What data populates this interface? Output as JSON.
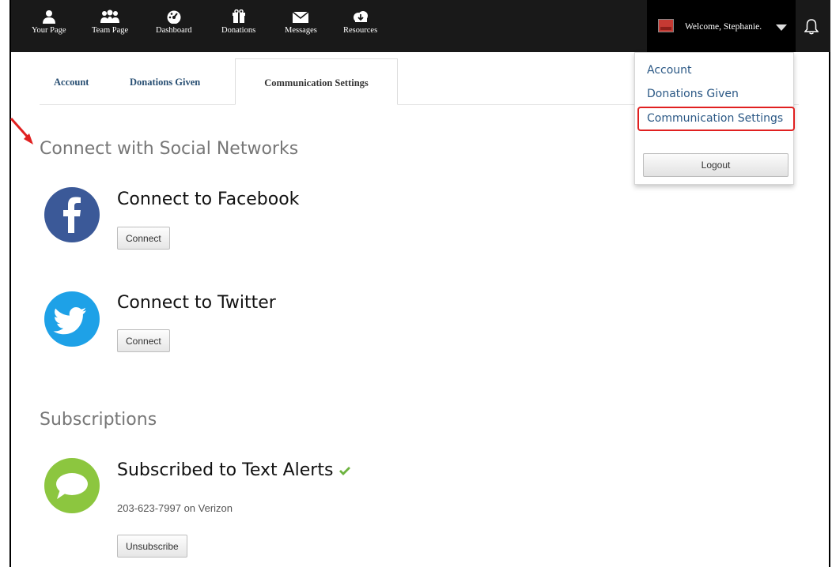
{
  "nav": {
    "items": [
      {
        "label": "Your Page",
        "icon": "user-icon"
      },
      {
        "label": "Team Page",
        "icon": "team-icon"
      },
      {
        "label": "Dashboard",
        "icon": "dashboard-icon"
      },
      {
        "label": "Donations",
        "icon": "gift-icon"
      },
      {
        "label": "Messages",
        "icon": "envelope-icon"
      },
      {
        "label": "Resources",
        "icon": "cloud-download-icon"
      }
    ],
    "welcome": "Welcome, Stephanie."
  },
  "tabs": [
    {
      "label": "Account"
    },
    {
      "label": "Donations Given"
    },
    {
      "label": "Communication Settings"
    }
  ],
  "social": {
    "title": "Connect with Social Networks",
    "facebook": {
      "title": "Connect to Facebook",
      "button": "Connect"
    },
    "twitter": {
      "title": "Connect to Twitter",
      "button": "Connect"
    }
  },
  "subscriptions": {
    "title": "Subscriptions",
    "text_alerts": {
      "title": "Subscribed to Text Alerts",
      "phone": "203-623-7997 on Verizon",
      "button": "Unsubscribe"
    }
  },
  "dropdown": {
    "items": [
      "Account",
      "Donations Given",
      "Communication Settings"
    ],
    "logout": "Logout"
  },
  "colors": {
    "facebook": "#3b5998",
    "twitter": "#1ea1e7",
    "sms": "#8cc63f",
    "highlight": "#e02020",
    "link": "#2b5885"
  }
}
